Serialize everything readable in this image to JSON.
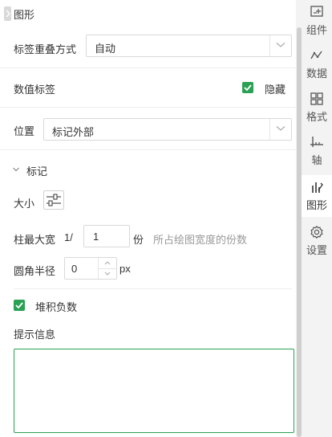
{
  "panel": {
    "title": "图形",
    "label_overlap": {
      "label": "标签重叠方式",
      "value": "自动"
    },
    "value_label": {
      "label": "数值标签",
      "checkbox_label": "隐藏",
      "checked": true
    },
    "position": {
      "label": "位置",
      "value": "标记外部"
    },
    "marker": {
      "title": "标记",
      "size_label": "大小",
      "max_width": {
        "label": "柱最大宽",
        "prefix": "1/",
        "value": "1",
        "unit": "份",
        "hint": "所占绘图宽度的份数"
      },
      "corner_radius": {
        "label": "圆角半径",
        "value": "0",
        "unit": "px"
      }
    },
    "stack_negative": {
      "label": "堆积负数",
      "checked": true
    },
    "tooltip": {
      "label": "提示信息",
      "value": ""
    }
  },
  "sidebar": {
    "items": [
      {
        "label": "组件",
        "icon": "component-icon"
      },
      {
        "label": "数据",
        "icon": "data-icon"
      },
      {
        "label": "格式",
        "icon": "format-icon"
      },
      {
        "label": "轴",
        "icon": "axis-icon"
      },
      {
        "label": "图形",
        "icon": "chart-shape-icon",
        "active": true
      },
      {
        "label": "设置",
        "icon": "settings-icon"
      }
    ]
  },
  "colors": {
    "accent": "#2aa154",
    "sidebar_bg": "#f3f3f3"
  }
}
